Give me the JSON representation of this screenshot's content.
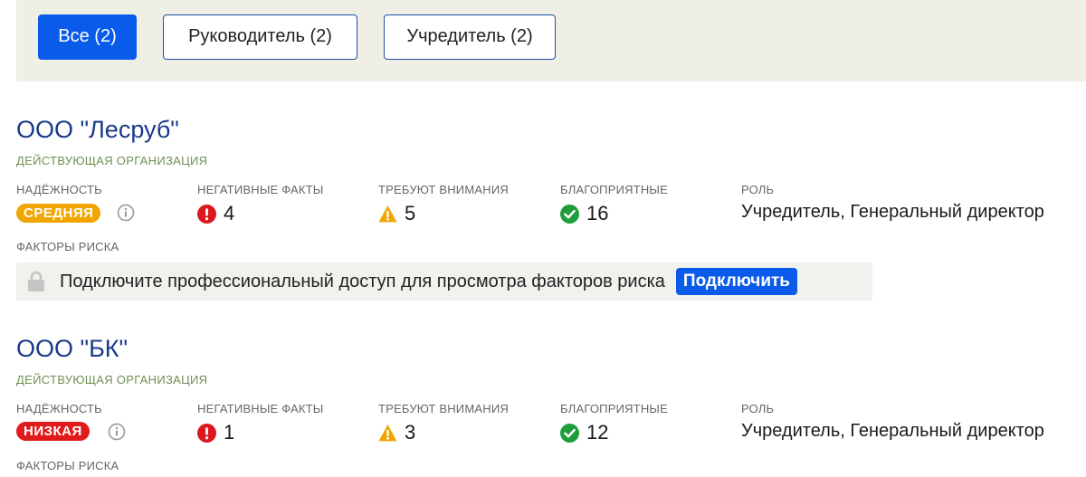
{
  "filters": [
    {
      "label": "Все (2)",
      "active": true
    },
    {
      "label": "Руководитель (2)",
      "active": false
    },
    {
      "label": "Учредитель (2)",
      "active": false
    }
  ],
  "labels": {
    "reliability": "НАДЁЖНОСТЬ",
    "negative": "НЕГАТИВНЫЕ ФАКТЫ",
    "attention": "ТРЕБУЮТ ВНИМАНИЯ",
    "favorable": "БЛАГОПРИЯТНЫЕ",
    "role": "РОЛЬ",
    "risk_factors": "ФАКТОРЫ РИСКА"
  },
  "organizations": [
    {
      "name": "ООО \"Лесруб\"",
      "status": "ДЕЙСТВУЮЩАЯ ОРГАНИЗАЦИЯ",
      "reliability": {
        "label": "СРЕДНЯЯ",
        "color": "#f0a500"
      },
      "negative": "4",
      "attention": "5",
      "favorable": "16",
      "role": "Учредитель, Генеральный директор",
      "risk_lock": {
        "text": "Подключите профессиональный доступ для просмотра факторов риска",
        "button": "Подключить"
      }
    },
    {
      "name": "ООО \"БК\"",
      "status": "ДЕЙСТВУЮЩАЯ ОРГАНИЗАЦИЯ",
      "reliability": {
        "label": "НИЗКАЯ",
        "color": "#e01b1b"
      },
      "negative": "1",
      "attention": "3",
      "favorable": "12",
      "role": "Учредитель, Генеральный директор"
    }
  ],
  "colors": {
    "accent": "#0a5bea",
    "negative": "#d9181f",
    "warning": "#f0a500",
    "positive": "#1e9e3a",
    "org_name": "#1b3a8a",
    "status": "#6f8f52"
  },
  "icons": {
    "negative": "exclamation-circle-icon",
    "attention": "warning-triangle-icon",
    "favorable": "check-circle-icon",
    "info": "info-icon",
    "lock": "lock-icon"
  }
}
